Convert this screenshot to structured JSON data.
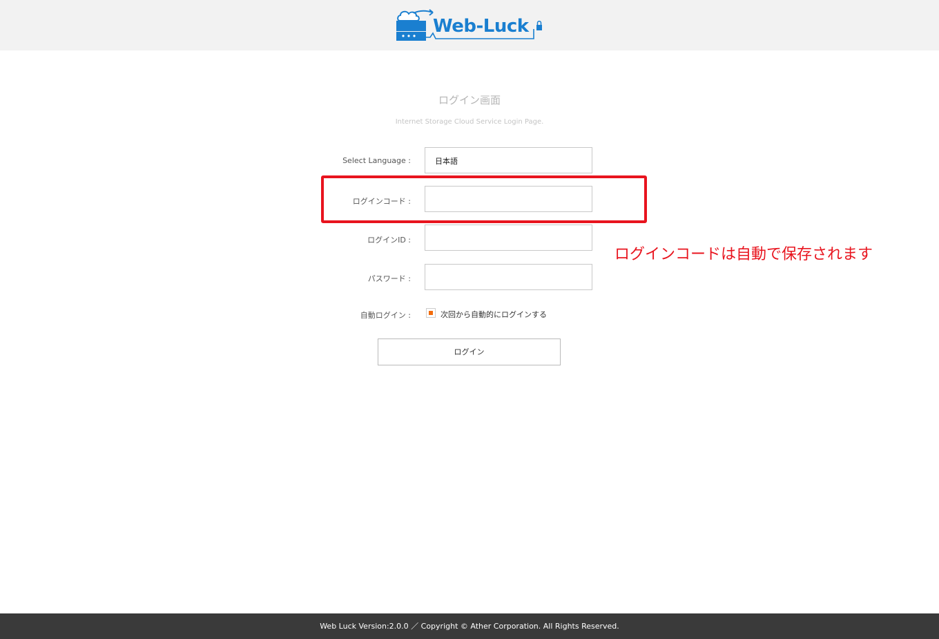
{
  "header": {
    "logo_text": "Web-Luck"
  },
  "page": {
    "title": "ログイン画面",
    "subtitle": "Internet Storage Cloud Service Login Page."
  },
  "form": {
    "language": {
      "label": "Select Language :",
      "value": "日本語"
    },
    "login_code": {
      "label": "ログインコード :",
      "value": ""
    },
    "login_id": {
      "label": "ログインID :",
      "value": ""
    },
    "password": {
      "label": "パスワード :",
      "value": ""
    },
    "auto_login": {
      "label": "自動ログイン :",
      "checkbox_label": "次回から自動的にログインする",
      "checked": true
    },
    "submit_label": "ログイン"
  },
  "annotation": {
    "text": "ログインコードは自動で保存されます",
    "color": "#e8141e"
  },
  "footer": {
    "text": "Web Luck Version:2.0.0 ／ Copyright © Ather Corporation. All Rights Reserved."
  },
  "colors": {
    "brand_blue": "#1a7fd0",
    "checkbox_accent": "#f26c0d",
    "footer_bg": "#3a3a3a"
  }
}
